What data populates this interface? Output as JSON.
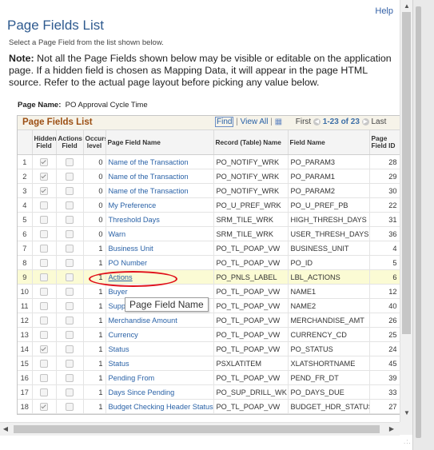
{
  "help_label": "Help",
  "page_title": "Page Fields List",
  "instruction": "Select a Page Field from the list shown below.",
  "note_label": "Note:",
  "note_text": " Not all the Page Fields shown below may be visible or editable on the application page. If a hidden field is chosen as Mapping Data, it will appear in the page HTML source. Refer to the actual page layout before picking any value below.",
  "page_name_label": "Page Name:",
  "page_name_value": "PO Approval Cycle Time",
  "grid": {
    "title": "Page Fields List",
    "find": "Find",
    "sep1": "|",
    "view_all": "View All",
    "sep2": "|",
    "first": "First",
    "range": "1-23 of 23",
    "last": "Last",
    "columns": [
      "Hidden Field",
      "Actions Field",
      "Occurs level",
      "Page Field Name",
      "Record (Table) Name",
      "Field Name",
      "Page Field ID"
    ],
    "rows": [
      {
        "n": "1",
        "hidden": true,
        "actions": false,
        "occurs": "0",
        "pfname": "Name of the Transaction",
        "record": "PO_NOTIFY_WRK",
        "field": "PO_PARAM3",
        "id": "28"
      },
      {
        "n": "2",
        "hidden": true,
        "actions": false,
        "occurs": "0",
        "pfname": "Name of the Transaction",
        "record": "PO_NOTIFY_WRK",
        "field": "PO_PARAM1",
        "id": "29"
      },
      {
        "n": "3",
        "hidden": true,
        "actions": false,
        "occurs": "0",
        "pfname": "Name of the Transaction",
        "record": "PO_NOTIFY_WRK",
        "field": "PO_PARAM2",
        "id": "30"
      },
      {
        "n": "4",
        "hidden": false,
        "actions": false,
        "occurs": "0",
        "pfname": "My Preference",
        "record": "PO_U_PREF_WRK",
        "field": "PO_U_PREF_PB",
        "id": "22"
      },
      {
        "n": "5",
        "hidden": false,
        "actions": false,
        "occurs": "0",
        "pfname": "Threshold Days",
        "record": "SRM_TILE_WRK",
        "field": "HIGH_THRESH_DAYS",
        "id": "31"
      },
      {
        "n": "6",
        "hidden": false,
        "actions": false,
        "occurs": "0",
        "pfname": "Warn",
        "record": "SRM_TILE_WRK",
        "field": "USER_THRESH_DAYS",
        "id": "36"
      },
      {
        "n": "7",
        "hidden": false,
        "actions": false,
        "occurs": "1",
        "pfname": "Business Unit",
        "record": "PO_TL_POAP_VW",
        "field": "BUSINESS_UNIT",
        "id": "4"
      },
      {
        "n": "8",
        "hidden": false,
        "actions": false,
        "occurs": "1",
        "pfname": "PO Number",
        "record": "PO_TL_POAP_VW",
        "field": "PO_ID",
        "id": "5"
      },
      {
        "n": "9",
        "hidden": false,
        "actions": false,
        "occurs": "1",
        "pfname": "Actions",
        "record": "PO_PNLS_LABEL",
        "field": "LBL_ACTIONS",
        "id": "6",
        "highlight": true
      },
      {
        "n": "10",
        "hidden": false,
        "actions": false,
        "occurs": "1",
        "pfname": "Buyer",
        "record": "PO_TL_POAP_VW",
        "field": "NAME1",
        "id": "12"
      },
      {
        "n": "11",
        "hidden": false,
        "actions": false,
        "occurs": "1",
        "pfname": "Supp",
        "record": "PO_TL_POAP_VW",
        "field": "NAME2",
        "id": "40"
      },
      {
        "n": "12",
        "hidden": false,
        "actions": false,
        "occurs": "1",
        "pfname": "Merchandise Amount",
        "record": "PO_TL_POAP_VW",
        "field": "MERCHANDISE_AMT",
        "id": "26"
      },
      {
        "n": "13",
        "hidden": false,
        "actions": false,
        "occurs": "1",
        "pfname": "Currency",
        "record": "PO_TL_POAP_VW",
        "field": "CURRENCY_CD",
        "id": "25"
      },
      {
        "n": "14",
        "hidden": true,
        "actions": false,
        "occurs": "1",
        "pfname": "Status",
        "record": "PO_TL_POAP_VW",
        "field": "PO_STATUS",
        "id": "24"
      },
      {
        "n": "15",
        "hidden": false,
        "actions": false,
        "occurs": "1",
        "pfname": "Status",
        "record": "PSXLATITEM",
        "field": "XLATSHORTNAME",
        "id": "45"
      },
      {
        "n": "16",
        "hidden": false,
        "actions": false,
        "occurs": "1",
        "pfname": "Pending From",
        "record": "PO_TL_POAP_VW",
        "field": "PEND_FR_DT",
        "id": "39"
      },
      {
        "n": "17",
        "hidden": false,
        "actions": false,
        "occurs": "1",
        "pfname": "Days Since Pending",
        "record": "PO_SUP_DRILL_WK",
        "field": "PO_DAYS_DUE",
        "id": "33"
      },
      {
        "n": "18",
        "hidden": true,
        "actions": false,
        "occurs": "1",
        "pfname": "Budget Checking Header Status",
        "record": "PO_TL_POAP_VW",
        "field": "BUDGET_HDR_STATUS",
        "id": "27"
      }
    ]
  },
  "tooltip": "Page Field Name"
}
